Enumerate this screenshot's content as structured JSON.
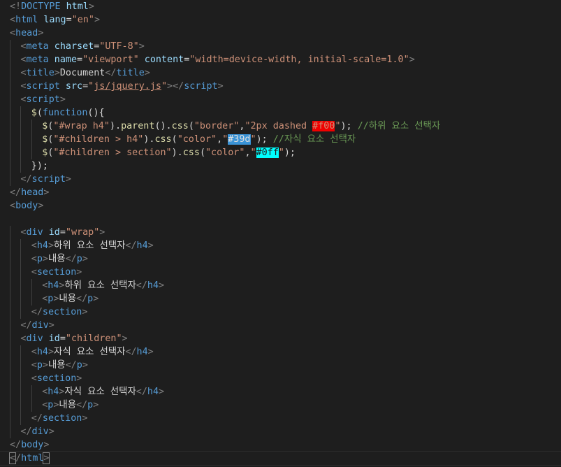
{
  "editor": {
    "language": "html",
    "theme_colors": {
      "background": "#1e1e1e",
      "tag": "#569cd6",
      "attribute": "#9cdcfe",
      "string": "#ce9178",
      "function": "#dcdcaa",
      "comment": "#6a9955",
      "punctuation": "#808080",
      "text": "#d4d4d4"
    },
    "swatches": {
      "f00": "#ff0000",
      "39d": "#3399dd",
      "0ff": "#00ffff"
    },
    "lines": [
      {
        "indent": 0,
        "tokens": [
          [
            "punct",
            "<!"
          ],
          [
            "tag",
            "DOCTYPE"
          ],
          [
            "plain",
            " "
          ],
          [
            "attr",
            "html"
          ],
          [
            "punct",
            ">"
          ]
        ]
      },
      {
        "indent": 0,
        "tokens": [
          [
            "punct",
            "<"
          ],
          [
            "tag",
            "html"
          ],
          [
            "plain",
            " "
          ],
          [
            "attr",
            "lang"
          ],
          [
            "plain",
            "="
          ],
          [
            "str",
            "\"en\""
          ],
          [
            "punct",
            ">"
          ]
        ]
      },
      {
        "indent": 0,
        "tokens": [
          [
            "punct",
            "<"
          ],
          [
            "tag",
            "head"
          ],
          [
            "punct",
            ">"
          ]
        ]
      },
      {
        "indent": 1,
        "tokens": [
          [
            "punct",
            "<"
          ],
          [
            "tag",
            "meta"
          ],
          [
            "plain",
            " "
          ],
          [
            "attr",
            "charset"
          ],
          [
            "plain",
            "="
          ],
          [
            "str",
            "\"UTF-8\""
          ],
          [
            "punct",
            ">"
          ]
        ]
      },
      {
        "indent": 1,
        "tokens": [
          [
            "punct",
            "<"
          ],
          [
            "tag",
            "meta"
          ],
          [
            "plain",
            " "
          ],
          [
            "attr",
            "name"
          ],
          [
            "plain",
            "="
          ],
          [
            "str",
            "\"viewport\""
          ],
          [
            "plain",
            " "
          ],
          [
            "attr",
            "content"
          ],
          [
            "plain",
            "="
          ],
          [
            "str",
            "\"width=device-width, initial-scale=1.0\""
          ],
          [
            "punct",
            ">"
          ]
        ]
      },
      {
        "indent": 1,
        "tokens": [
          [
            "punct",
            "<"
          ],
          [
            "tag",
            "title"
          ],
          [
            "punct",
            ">"
          ],
          [
            "text",
            "Document"
          ],
          [
            "punct",
            "</"
          ],
          [
            "tag",
            "title"
          ],
          [
            "punct",
            ">"
          ]
        ]
      },
      {
        "indent": 1,
        "tokens": [
          [
            "punct",
            "<"
          ],
          [
            "tag",
            "script"
          ],
          [
            "plain",
            " "
          ],
          [
            "attr",
            "src"
          ],
          [
            "plain",
            "="
          ],
          [
            "str",
            "\""
          ],
          [
            "strU",
            "js/jquery.js"
          ],
          [
            "str",
            "\""
          ],
          [
            "punct",
            ">"
          ],
          [
            "punct",
            "</"
          ],
          [
            "tag",
            "script"
          ],
          [
            "punct",
            ">"
          ]
        ]
      },
      {
        "indent": 1,
        "tokens": [
          [
            "punct",
            "<"
          ],
          [
            "tag",
            "script"
          ],
          [
            "punct",
            ">"
          ]
        ]
      },
      {
        "indent": 2,
        "tokens": [
          [
            "fn",
            "$"
          ],
          [
            "plain",
            "("
          ],
          [
            "kw",
            "function"
          ],
          [
            "plain",
            "(){"
          ]
        ]
      },
      {
        "indent": 3,
        "tokens": [
          [
            "fn",
            "$"
          ],
          [
            "plain",
            "("
          ],
          [
            "str",
            "\"#wrap h4\""
          ],
          [
            "plain",
            ")."
          ],
          [
            "fn",
            "parent"
          ],
          [
            "plain",
            "()."
          ],
          [
            "fn",
            "css"
          ],
          [
            "plain",
            "("
          ],
          [
            "str",
            "\"border\""
          ],
          [
            "plain",
            ","
          ],
          [
            "str",
            "\"2px dashed "
          ],
          [
            "swred",
            "#f00"
          ],
          [
            "str",
            "\""
          ],
          [
            "plain",
            ");"
          ],
          [
            "plain",
            " "
          ],
          [
            "comment",
            "//하위 요소 선택자"
          ]
        ]
      },
      {
        "indent": 3,
        "tokens": [
          [
            "fn",
            "$"
          ],
          [
            "plain",
            "("
          ],
          [
            "str",
            "\"#children > h4\""
          ],
          [
            "plain",
            ")."
          ],
          [
            "fn",
            "css"
          ],
          [
            "plain",
            "("
          ],
          [
            "str",
            "\"color\""
          ],
          [
            "plain",
            ","
          ],
          [
            "str",
            "\""
          ],
          [
            "swblue",
            "#39d"
          ],
          [
            "str",
            "\""
          ],
          [
            "plain",
            ");"
          ],
          [
            "plain",
            " "
          ],
          [
            "comment",
            "//자식 요소 선택자"
          ]
        ]
      },
      {
        "indent": 3,
        "tokens": [
          [
            "fn",
            "$"
          ],
          [
            "plain",
            "("
          ],
          [
            "str",
            "\"#children > section\""
          ],
          [
            "plain",
            ")."
          ],
          [
            "fn",
            "css"
          ],
          [
            "plain",
            "("
          ],
          [
            "str",
            "\"color\""
          ],
          [
            "plain",
            ","
          ],
          [
            "str",
            "\""
          ],
          [
            "swcyan",
            "#0ff"
          ],
          [
            "str",
            "\""
          ],
          [
            "plain",
            ");"
          ]
        ]
      },
      {
        "indent": 2,
        "tokens": [
          [
            "plain",
            "});"
          ]
        ]
      },
      {
        "indent": 1,
        "tokens": [
          [
            "punct",
            "</"
          ],
          [
            "tag",
            "script"
          ],
          [
            "punct",
            ">"
          ]
        ]
      },
      {
        "indent": 0,
        "tokens": [
          [
            "punct",
            "</"
          ],
          [
            "tag",
            "head"
          ],
          [
            "punct",
            ">"
          ]
        ]
      },
      {
        "indent": 0,
        "tokens": [
          [
            "punct",
            "<"
          ],
          [
            "tag",
            "body"
          ],
          [
            "punct",
            ">"
          ]
        ]
      },
      {
        "indent": 0,
        "tokens": []
      },
      {
        "indent": 1,
        "tokens": [
          [
            "punct",
            "<"
          ],
          [
            "tag",
            "div"
          ],
          [
            "plain",
            " "
          ],
          [
            "attr",
            "id"
          ],
          [
            "plain",
            "="
          ],
          [
            "str",
            "\"wrap\""
          ],
          [
            "punct",
            ">"
          ]
        ]
      },
      {
        "indent": 2,
        "tokens": [
          [
            "punct",
            "<"
          ],
          [
            "tag",
            "h4"
          ],
          [
            "punct",
            ">"
          ],
          [
            "text",
            "하위 요소 선택자"
          ],
          [
            "punct",
            "</"
          ],
          [
            "tag",
            "h4"
          ],
          [
            "punct",
            ">"
          ]
        ]
      },
      {
        "indent": 2,
        "tokens": [
          [
            "punct",
            "<"
          ],
          [
            "tag",
            "p"
          ],
          [
            "punct",
            ">"
          ],
          [
            "text",
            "내용"
          ],
          [
            "punct",
            "</"
          ],
          [
            "tag",
            "p"
          ],
          [
            "punct",
            ">"
          ]
        ]
      },
      {
        "indent": 2,
        "tokens": [
          [
            "punct",
            "<"
          ],
          [
            "tag",
            "section"
          ],
          [
            "punct",
            ">"
          ]
        ]
      },
      {
        "indent": 3,
        "tokens": [
          [
            "punct",
            "<"
          ],
          [
            "tag",
            "h4"
          ],
          [
            "punct",
            ">"
          ],
          [
            "text",
            "하위 요소 선택자"
          ],
          [
            "punct",
            "</"
          ],
          [
            "tag",
            "h4"
          ],
          [
            "punct",
            ">"
          ]
        ]
      },
      {
        "indent": 3,
        "tokens": [
          [
            "punct",
            "<"
          ],
          [
            "tag",
            "p"
          ],
          [
            "punct",
            ">"
          ],
          [
            "text",
            "내용"
          ],
          [
            "punct",
            "</"
          ],
          [
            "tag",
            "p"
          ],
          [
            "punct",
            ">"
          ]
        ]
      },
      {
        "indent": 2,
        "tokens": [
          [
            "punct",
            "</"
          ],
          [
            "tag",
            "section"
          ],
          [
            "punct",
            ">"
          ]
        ]
      },
      {
        "indent": 1,
        "tokens": [
          [
            "punct",
            "</"
          ],
          [
            "tag",
            "div"
          ],
          [
            "punct",
            ">"
          ]
        ]
      },
      {
        "indent": 1,
        "tokens": [
          [
            "punct",
            "<"
          ],
          [
            "tag",
            "div"
          ],
          [
            "plain",
            " "
          ],
          [
            "attr",
            "id"
          ],
          [
            "plain",
            "="
          ],
          [
            "str",
            "\"children\""
          ],
          [
            "punct",
            ">"
          ]
        ]
      },
      {
        "indent": 2,
        "tokens": [
          [
            "punct",
            "<"
          ],
          [
            "tag",
            "h4"
          ],
          [
            "punct",
            ">"
          ],
          [
            "text",
            "자식 요소 선택자"
          ],
          [
            "punct",
            "</"
          ],
          [
            "tag",
            "h4"
          ],
          [
            "punct",
            ">"
          ]
        ]
      },
      {
        "indent": 2,
        "tokens": [
          [
            "punct",
            "<"
          ],
          [
            "tag",
            "p"
          ],
          [
            "punct",
            ">"
          ],
          [
            "text",
            "내용"
          ],
          [
            "punct",
            "</"
          ],
          [
            "tag",
            "p"
          ],
          [
            "punct",
            ">"
          ]
        ]
      },
      {
        "indent": 2,
        "tokens": [
          [
            "punct",
            "<"
          ],
          [
            "tag",
            "section"
          ],
          [
            "punct",
            ">"
          ]
        ]
      },
      {
        "indent": 3,
        "tokens": [
          [
            "punct",
            "<"
          ],
          [
            "tag",
            "h4"
          ],
          [
            "punct",
            ">"
          ],
          [
            "text",
            "자식 요소 선택자"
          ],
          [
            "punct",
            "</"
          ],
          [
            "tag",
            "h4"
          ],
          [
            "punct",
            ">"
          ]
        ]
      },
      {
        "indent": 3,
        "tokens": [
          [
            "punct",
            "<"
          ],
          [
            "tag",
            "p"
          ],
          [
            "punct",
            ">"
          ],
          [
            "text",
            "내용"
          ],
          [
            "punct",
            "</"
          ],
          [
            "tag",
            "p"
          ],
          [
            "punct",
            ">"
          ]
        ]
      },
      {
        "indent": 2,
        "tokens": [
          [
            "punct",
            "</"
          ],
          [
            "tag",
            "section"
          ],
          [
            "punct",
            ">"
          ]
        ]
      },
      {
        "indent": 1,
        "tokens": [
          [
            "punct",
            "</"
          ],
          [
            "tag",
            "div"
          ],
          [
            "punct",
            ">"
          ]
        ]
      },
      {
        "indent": 0,
        "tokens": [
          [
            "punct",
            "</"
          ],
          [
            "tag",
            "body"
          ],
          [
            "punct",
            ">"
          ]
        ]
      },
      {
        "indent": 0,
        "current": true,
        "tokens": [
          [
            "cursor",
            "<"
          ],
          [
            "punct",
            "/"
          ],
          [
            "tag",
            "html"
          ],
          [
            "cursor",
            ">"
          ]
        ]
      }
    ]
  }
}
